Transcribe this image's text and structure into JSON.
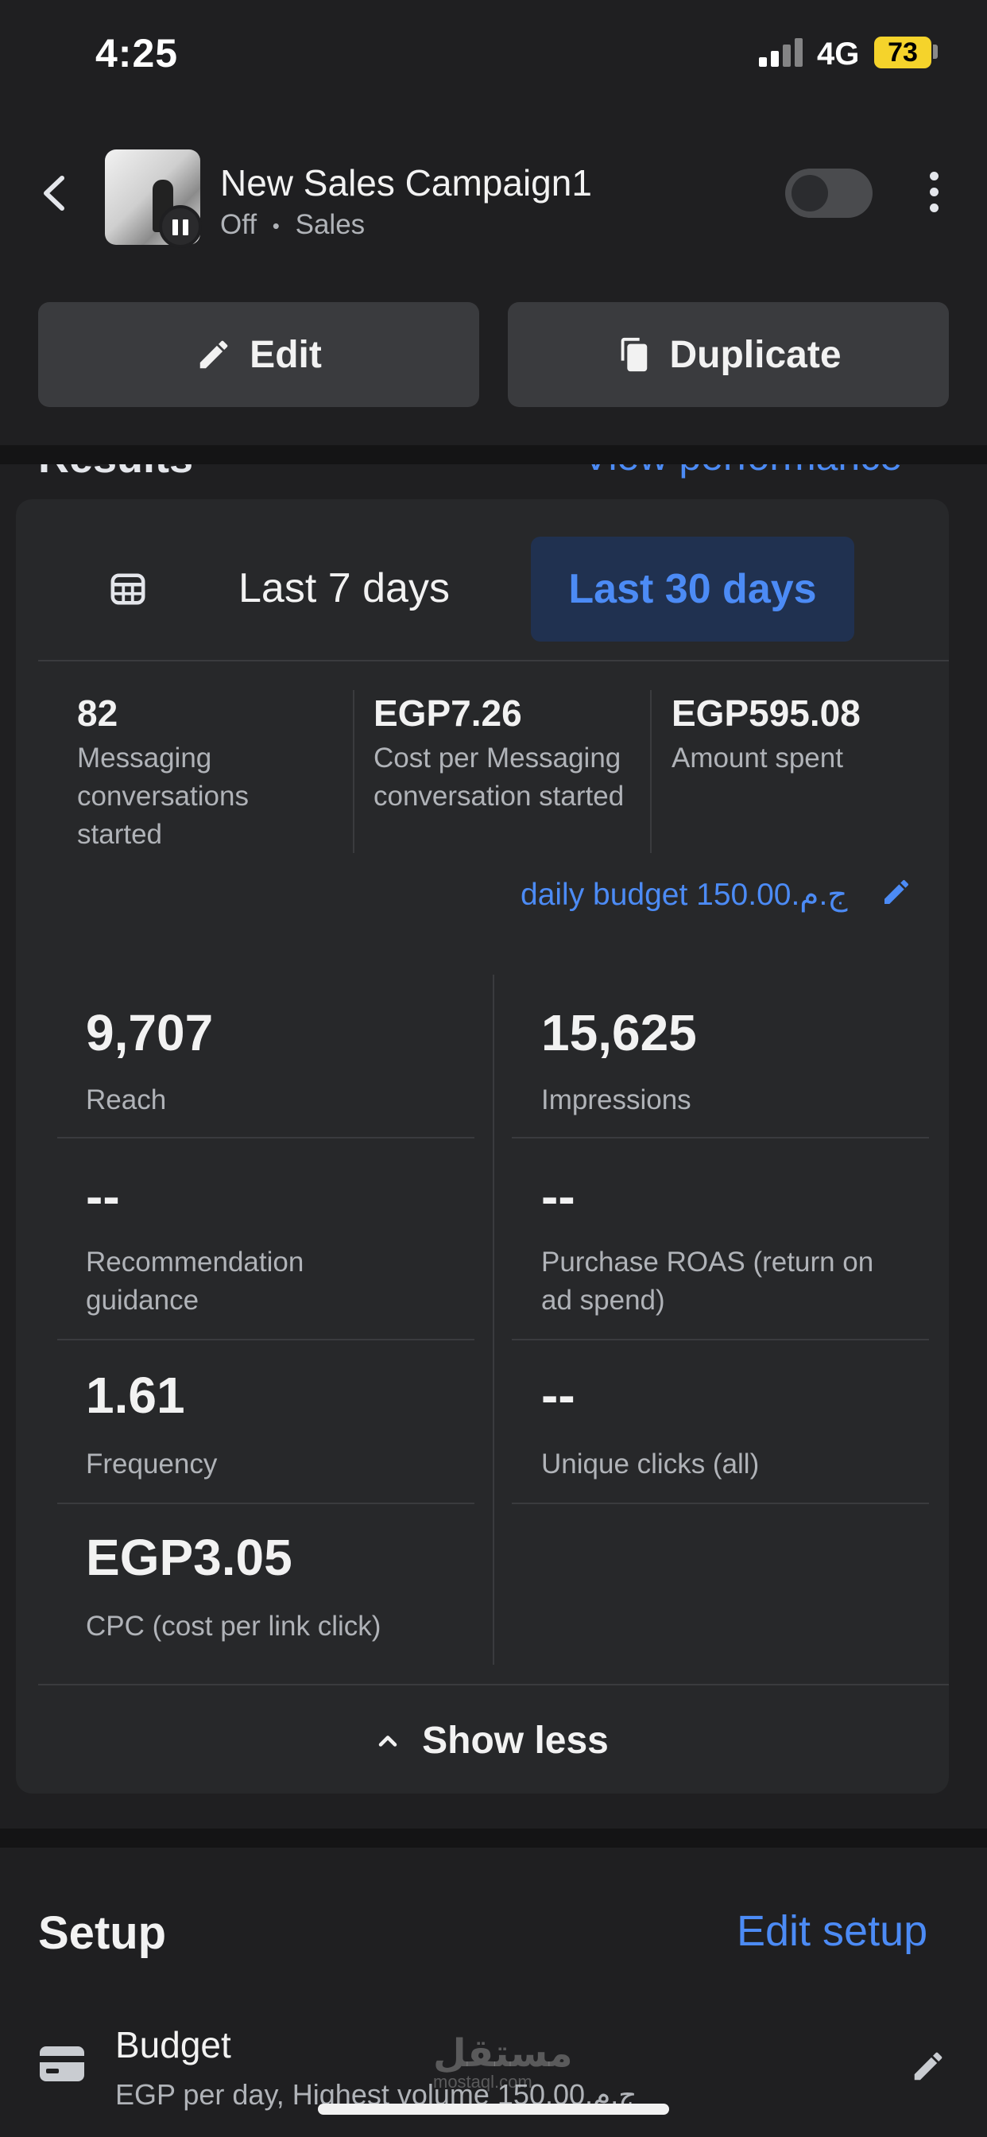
{
  "status_bar": {
    "time": "4:25",
    "network": "4G",
    "battery": "73"
  },
  "header": {
    "title": "New Sales Campaign1",
    "status": "Off",
    "objective": "Sales",
    "separator": "•",
    "toggle_on": false
  },
  "actions": {
    "edit_label": "Edit",
    "duplicate_label": "Duplicate"
  },
  "results": {
    "title": "Results",
    "view_performance": "View performance",
    "ranges": [
      "Last 7 days",
      "Last 30 days"
    ],
    "selected_range": "Last 30 days",
    "kpis": [
      {
        "value": "82",
        "label": "Messaging conversations started"
      },
      {
        "value": "EGP7.26",
        "label": "Cost per Messaging conversation started"
      },
      {
        "value": "EGP595.08",
        "label": "Amount spent"
      }
    ],
    "daily_budget": "daily budget 150.00.ج.م",
    "metrics": [
      {
        "value": "9,707",
        "label": "Reach"
      },
      {
        "value": "15,625",
        "label": "Impressions"
      },
      {
        "value": "--",
        "label": "Recommendation guidance"
      },
      {
        "value": "--",
        "label": "Purchase ROAS (return on ad spend)"
      },
      {
        "value": "1.61",
        "label": "Frequency"
      },
      {
        "value": "--",
        "label": "Unique clicks (all)"
      },
      {
        "value": "EGP3.05",
        "label": "CPC (cost per link click)"
      }
    ],
    "show_less": "Show less"
  },
  "setup": {
    "title": "Setup",
    "edit_setup": "Edit setup",
    "budget_title": "Budget",
    "budget_sub": "EGP per day, Highest volume 150.00.ج.م"
  },
  "watermark": {
    "text": "مستقل",
    "sub": "mostaql.com"
  },
  "colors": {
    "accent": "#4c8bf5",
    "background": "#1f1f21",
    "card": "#27282a",
    "selected_tab": "#203150",
    "battery": "#f5d32b"
  }
}
